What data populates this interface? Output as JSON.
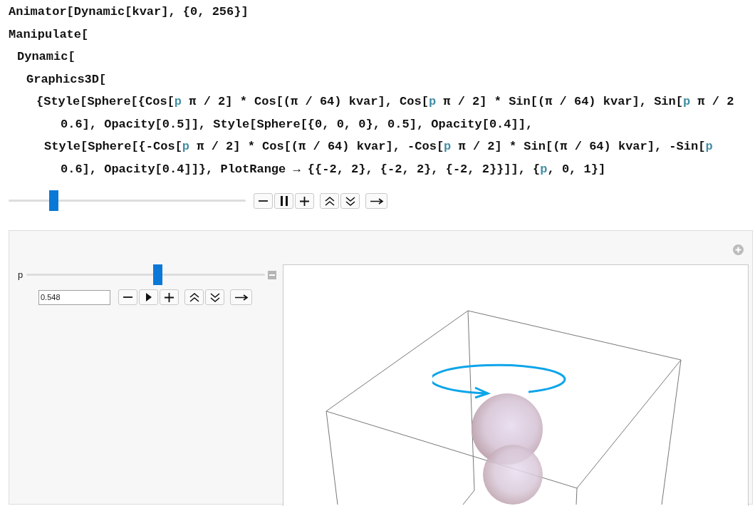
{
  "code_lines": [
    {
      "segments": [
        {
          "text": "Animator[Dynamic[kvar], {0, 256}]",
          "kind": "plain"
        }
      ]
    },
    {
      "segments": [
        {
          "text": "Manipulate[",
          "kind": "plain"
        }
      ]
    },
    {
      "segments": [
        {
          "text": "Dynamic[",
          "kind": "plain"
        }
      ]
    },
    {
      "segments": [
        {
          "text": "Graphics3D[",
          "kind": "plain"
        }
      ]
    },
    {
      "segments": [
        {
          "text": "{Style[Sphere[{Cos[",
          "kind": "plain"
        },
        {
          "text": "p",
          "kind": "variable"
        },
        {
          "text": " π / 2] * Cos[(π / 64) kvar], Cos[",
          "kind": "plain"
        },
        {
          "text": "p",
          "kind": "variable"
        },
        {
          "text": " π / 2] * Sin[(π / 64) kvar], Sin[",
          "kind": "plain"
        },
        {
          "text": "p",
          "kind": "variable"
        },
        {
          "text": " π / 2",
          "kind": "plain"
        }
      ]
    },
    {
      "segments": [
        {
          "text": "0.6], Opacity[0.5]], Style[Sphere[{0, 0, 0}, 0.5], Opacity[0.4]],",
          "kind": "plain"
        }
      ]
    },
    {
      "segments": [
        {
          "text": "Style[Sphere[{-Cos[",
          "kind": "plain"
        },
        {
          "text": "p",
          "kind": "variable"
        },
        {
          "text": " π / 2] * Cos[(π / 64) kvar], -Cos[",
          "kind": "plain"
        },
        {
          "text": "p",
          "kind": "variable"
        },
        {
          "text": " π / 2] * Sin[(π / 64) kvar], -Sin[",
          "kind": "plain"
        },
        {
          "text": "p",
          "kind": "variable"
        }
      ]
    },
    {
      "segments": [
        {
          "text": "0.6], Opacity[0.4]]}, PlotRange → {{-2, 2}, {-2, 2}, {-2, 2}}]], {",
          "kind": "plain"
        },
        {
          "text": "p",
          "kind": "variable"
        },
        {
          "text": ", 0, 1}]",
          "kind": "plain"
        }
      ]
    }
  ],
  "animator": {
    "level": 0.19,
    "playing": true
  },
  "manipulate": {
    "label": "p",
    "level": 0.548,
    "value": "0.548",
    "playing": false
  }
}
